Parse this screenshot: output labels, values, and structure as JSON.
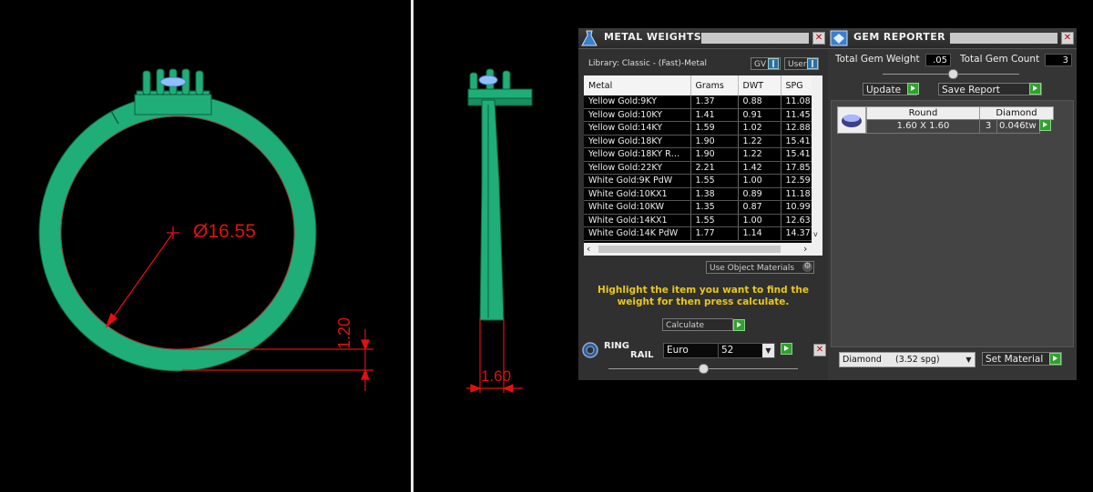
{
  "front_view": {
    "diameter_label": "Ø16.55",
    "thickness_label": "1.20"
  },
  "side_view": {
    "width_label": "1.60"
  },
  "metal_weights": {
    "title": "METAL WEIGHTS",
    "library_label": "Library: Classic - (Fast)-Metal",
    "gv_label": "GV",
    "user_label": "User",
    "columns": [
      "Metal",
      "Grams",
      "DWT",
      "SPG"
    ],
    "rows": [
      {
        "metal": "Yellow Gold:9KY",
        "grams": "1.37",
        "dwt": "0.88",
        "spg": "11.08"
      },
      {
        "metal": "Yellow Gold:10KY",
        "grams": "1.41",
        "dwt": "0.91",
        "spg": "11.45"
      },
      {
        "metal": "Yellow Gold:14KY",
        "grams": "1.59",
        "dwt": "1.02",
        "spg": "12.88"
      },
      {
        "metal": "Yellow Gold:18KY",
        "grams": "1.90",
        "dwt": "1.22",
        "spg": "15.41"
      },
      {
        "metal": "Yellow Gold:18KY R…",
        "grams": "1.90",
        "dwt": "1.22",
        "spg": "15.41"
      },
      {
        "metal": "Yellow Gold:22KY",
        "grams": "2.21",
        "dwt": "1.42",
        "spg": "17.85"
      },
      {
        "metal": "White Gold:9K PdW",
        "grams": "1.55",
        "dwt": "1.00",
        "spg": "12.59"
      },
      {
        "metal": "White Gold:10KX1",
        "grams": "1.38",
        "dwt": "0.89",
        "spg": "11.18"
      },
      {
        "metal": "White Gold:10KW",
        "grams": "1.35",
        "dwt": "0.87",
        "spg": "10.99"
      },
      {
        "metal": "White Gold:14KX1",
        "grams": "1.55",
        "dwt": "1.00",
        "spg": "12.63"
      },
      {
        "metal": "White Gold:14K PdW",
        "grams": "1.77",
        "dwt": "1.14",
        "spg": "14.37"
      }
    ],
    "use_object_materials": "Use Object Materials",
    "instruction": "Highlight the item you want to find the weight for then press calculate.",
    "calculate_label": "Calculate"
  },
  "ring_rail": {
    "title_line1": "RING",
    "title_line2": "RAIL",
    "standard": "Euro",
    "size": "52"
  },
  "gem_reporter": {
    "title": "GEM REPORTER",
    "total_weight_label": "Total Gem Weight",
    "total_weight_value": ".05",
    "total_count_label": "Total Gem Count",
    "total_count_value": "3",
    "update_label": "Update",
    "save_report_label": "Save Report",
    "gem": {
      "shape": "Round",
      "material": "Diamond",
      "size": "1.60 X 1.60",
      "count": "3",
      "weight": "0.046tw"
    },
    "material_select": "Diamond     (3.52 spg)",
    "set_material_label": "Set Material"
  },
  "colors": {
    "ring_green": "#1fae78",
    "dimension_red": "#e01010",
    "instruction_yellow": "#e8c81a",
    "button_green": "#2fa12f"
  }
}
